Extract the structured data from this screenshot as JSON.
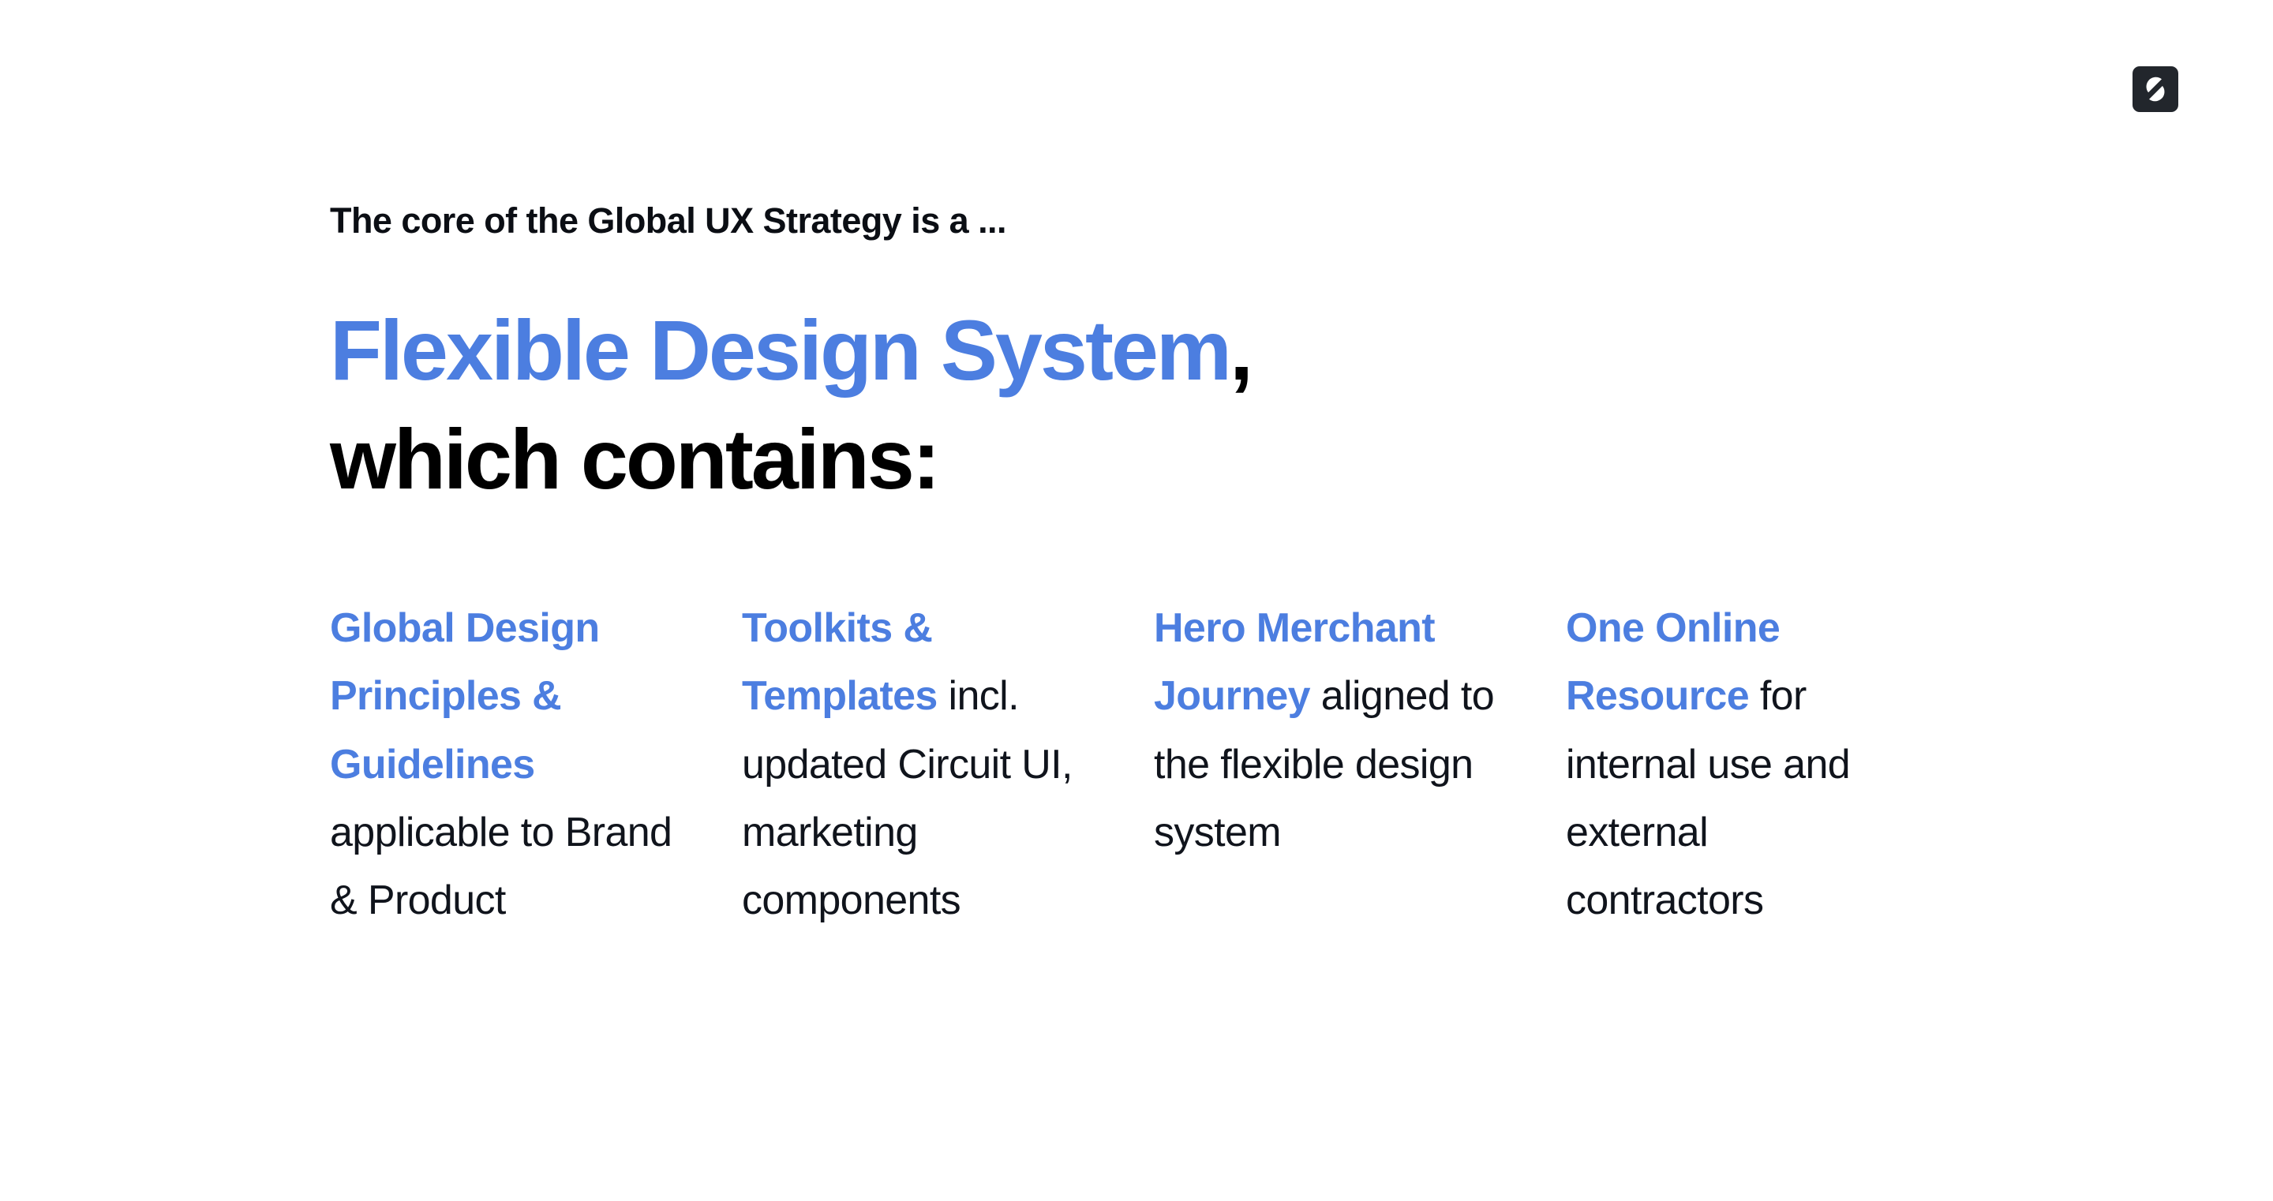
{
  "slide": {
    "background_color": "#ffffff",
    "accent_color": "#4c7ee0",
    "text_color": "#10141c",
    "logo": {
      "icon_name": "sumup-s-logo-icon",
      "background_color": "#22262c",
      "glyph_color": "#ffffff"
    },
    "eyebrow": "The core of the Global UX Strategy is a ...",
    "headline": {
      "accent_part": "Flexible Design System",
      "punctuation": ",",
      "plain_part": "which contains:"
    },
    "columns": [
      {
        "lead": "Global Design Principles & Guidelines",
        "rest": " applicable to Brand & Product"
      },
      {
        "lead": "Toolkits & Templates",
        "rest": " incl. updated Circuit UI, marketing components"
      },
      {
        "lead": "Hero Merchant Journey",
        "rest": " aligned to the flexible design system"
      },
      {
        "lead": "One Online Resource",
        "rest": " for internal use and external contractors"
      }
    ]
  }
}
